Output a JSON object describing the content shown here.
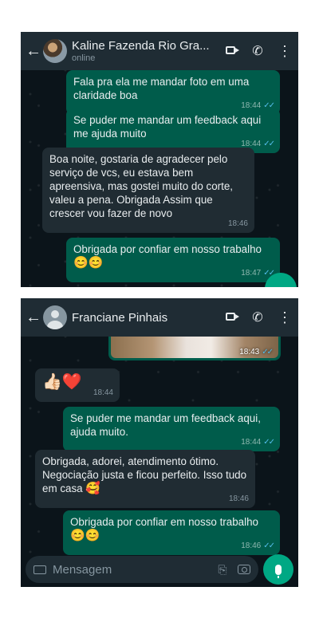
{
  "chat1": {
    "contact_name": "Kaline Fazenda Rio Gra...",
    "status": "online",
    "messages": [
      {
        "direction": "out",
        "text": "Fala pra ela me mandar foto em uma claridade boa",
        "time": "18:44",
        "read": true
      },
      {
        "direction": "out",
        "text": "Se puder me mandar um feedback aqui me ajuda muito",
        "time": "18:44",
        "read": true
      },
      {
        "direction": "in",
        "text": "Boa noite, gostaria de agradecer pelo serviço de vcs, eu estava bem apreensiva, mas gostei muito do corte, valeu a pena. Obrigada Assim que crescer vou fazer de novo",
        "time": "18:46"
      },
      {
        "direction": "out",
        "text": "Obrigada por confiar em nosso trabalho",
        "emoji": "😊😊",
        "time": "18:47",
        "read": true
      }
    ]
  },
  "chat2": {
    "contact_name": "Franciane Pinhais",
    "photo_time": "18:43",
    "messages": [
      {
        "direction": "in",
        "emoji": "👍🏻❤️",
        "time": "18:44"
      },
      {
        "direction": "out",
        "text": "Se puder me mandar um feedback aqui, ajuda muito.",
        "time": "18:44",
        "read": true
      },
      {
        "direction": "in",
        "text": "Obrigada, adorei, atendimento ótimo. Negociação justa e ficou perfeito. Isso tudo em casa",
        "emoji": "🥰",
        "time": "18:46"
      },
      {
        "direction": "out",
        "text": "Obrigada por confiar em nosso trabalho",
        "emoji": "😊😊",
        "time": "18:46",
        "read": true
      }
    ],
    "composer": {
      "placeholder": "Mensagem"
    }
  },
  "icons": {
    "back": "arrow-left-icon",
    "video": "video-camera-icon",
    "call": "phone-icon",
    "menu": "more-vertical-icon",
    "keyboard": "keyboard-icon",
    "attach": "paperclip-icon",
    "camera": "camera-icon",
    "mic": "microphone-icon",
    "read_receipt": "double-check-icon"
  },
  "colors": {
    "background": "#0b141a",
    "header": "#1f2c34",
    "outgoing_bubble": "#005c4b",
    "incoming_bubble": "#202c33",
    "accent": "#00a884",
    "read_tick": "#53bdeb"
  }
}
